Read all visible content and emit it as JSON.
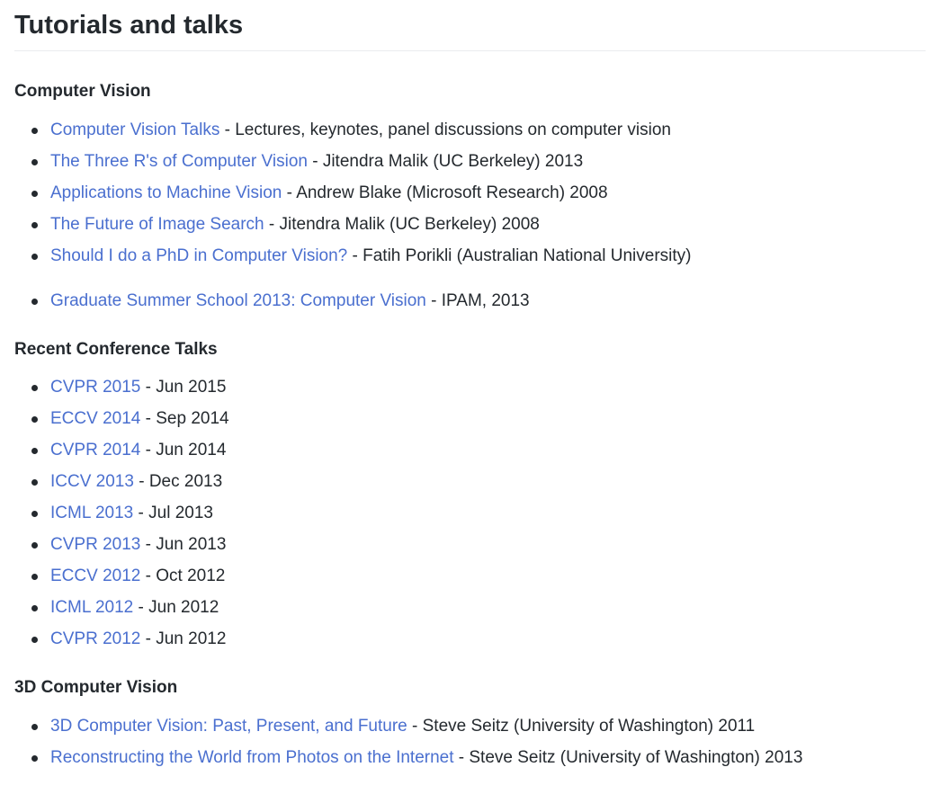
{
  "title": "Tutorials and talks",
  "sections": [
    {
      "heading": "Computer Vision",
      "items": [
        {
          "link": "Computer Vision Talks",
          "rest": " - Lectures, keynotes, panel discussions on computer vision"
        },
        {
          "link": "The Three R's of Computer Vision",
          "rest": " - Jitendra Malik (UC Berkeley) 2013"
        },
        {
          "link": "Applications to Machine Vision",
          "rest": " - Andrew Blake (Microsoft Research) 2008"
        },
        {
          "link": "The Future of Image Search",
          "rest": " - Jitendra Malik (UC Berkeley) 2008"
        },
        {
          "link": "Should I do a PhD in Computer Vision?",
          "rest": " - Fatih Porikli (Australian National University)"
        },
        {
          "link": "Graduate Summer School 2013: Computer Vision",
          "rest": " - IPAM, 2013"
        }
      ]
    },
    {
      "heading": "Recent Conference Talks",
      "items": [
        {
          "link": "CVPR 2015",
          "rest": " - Jun 2015"
        },
        {
          "link": "ECCV 2014",
          "rest": " - Sep 2014"
        },
        {
          "link": "CVPR 2014",
          "rest": " - Jun 2014"
        },
        {
          "link": "ICCV 2013",
          "rest": " - Dec 2013"
        },
        {
          "link": "ICML 2013",
          "rest": " - Jul 2013"
        },
        {
          "link": "CVPR 2013",
          "rest": " - Jun 2013"
        },
        {
          "link": "ECCV 2012",
          "rest": " - Oct 2012"
        },
        {
          "link": "ICML 2012",
          "rest": " - Jun 2012"
        },
        {
          "link": "CVPR 2012",
          "rest": " - Jun 2012"
        }
      ]
    },
    {
      "heading": "3D Computer Vision",
      "items": [
        {
          "link": "3D Computer Vision: Past, Present, and Future",
          "rest": " - Steve Seitz (University of Washington) 2011"
        },
        {
          "link": "Reconstructing the World from Photos on the Internet",
          "rest": " - Steve Seitz (University of Washington) 2013"
        }
      ]
    }
  ],
  "colors": {
    "link": "#4a6fcf",
    "text": "#24292e",
    "rule": "#eaecef"
  }
}
